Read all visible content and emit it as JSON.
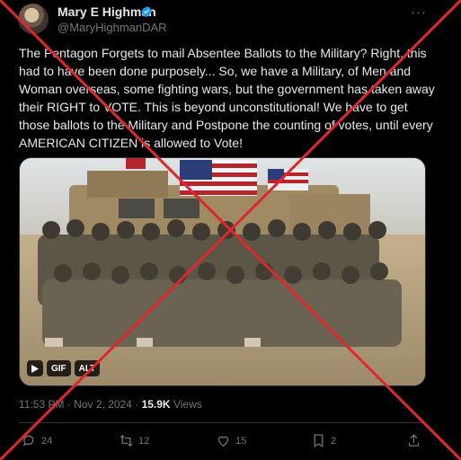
{
  "author": {
    "name": "Mary E Highman",
    "handle": "@MaryHighmanDAR",
    "verified_icon": "verified-badge-icon",
    "verified_color": "#1d9bf0"
  },
  "tweet": {
    "text": "The Pentagon Forgets to mail Absentee Ballots to the Military? Right, this had to have been done purposely... So, we have a Military, of Men and Woman overseas, some fighting wars, but the government has taken away their RIGHT to VOTE. This is beyond unconstitutional! We have to get those ballots to the Military and Postpone the counting of votes, until every AMERICAN CITIZEN is allowed to Vote!",
    "time": "11:53 PM",
    "separator": "·",
    "date": "Nov 2, 2024",
    "views_count": "15.9K",
    "views_label": "Views"
  },
  "media": {
    "gif_label": "GIF",
    "alt_label": "ALT",
    "play_icon": "play-icon"
  },
  "actions": {
    "reply_count": "24",
    "repost_count": "12",
    "like_count": "15",
    "bookmark_count": "2"
  },
  "colors": {
    "background": "#000000",
    "text": "#e7e9ea",
    "muted": "#71767b",
    "cross": "#e0272b"
  }
}
